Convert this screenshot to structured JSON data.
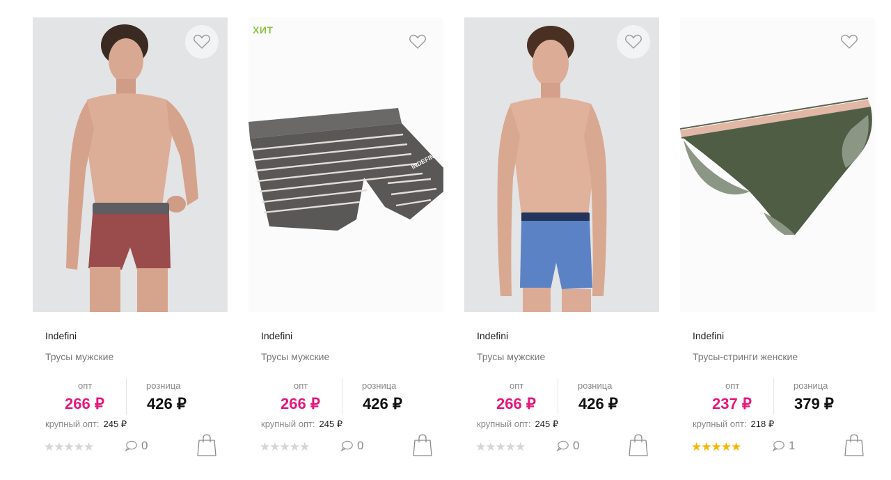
{
  "labels": {
    "opt": "опт",
    "retail": "розница",
    "bulk": "крупный опт:"
  },
  "colors": {
    "accent_price": "#e5187d",
    "hit_badge": "#8cc63f",
    "star_active": "#f7b500",
    "star_inactive": "#d5d5d5"
  },
  "products": [
    {
      "badge": "",
      "brand": "Indefini",
      "name": "Трусы мужские",
      "opt_price": "266 ₽",
      "retail_price": "426 ₽",
      "bulk_price": "245 ₽",
      "stars": "★★★★★",
      "rating": 0,
      "comments": "0",
      "image": "man-in-red-boxer-briefs"
    },
    {
      "badge": "ХИТ",
      "brand": "Indefini",
      "name": "Трусы мужские",
      "opt_price": "266 ₽",
      "retail_price": "426 ₽",
      "bulk_price": "245 ₽",
      "stars": "★★★★★",
      "rating": 0,
      "comments": "0",
      "image": "grey-striped-boxer-briefs"
    },
    {
      "badge": "",
      "brand": "Indefini",
      "name": "Трусы мужские",
      "opt_price": "266 ₽",
      "retail_price": "426 ₽",
      "bulk_price": "245 ₽",
      "stars": "★★★★★",
      "rating": 0,
      "comments": "0",
      "image": "man-in-blue-boxer-briefs"
    },
    {
      "badge": "",
      "brand": "Indefini",
      "name": "Трусы-стринги женские",
      "opt_price": "237 ₽",
      "retail_price": "379 ₽",
      "bulk_price": "218 ₽",
      "stars": "★★★★★",
      "rating": 5,
      "comments": "1",
      "image": "green-lace-thong"
    }
  ]
}
